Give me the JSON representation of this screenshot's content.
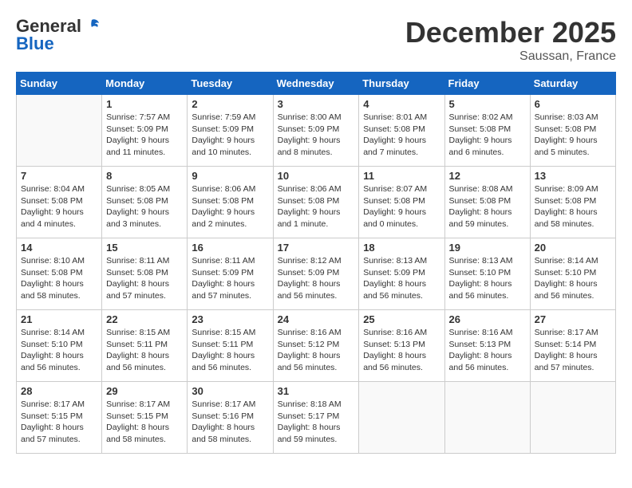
{
  "header": {
    "logo_general": "General",
    "logo_blue": "Blue",
    "month_year": "December 2025",
    "location": "Saussan, France"
  },
  "weekdays": [
    "Sunday",
    "Monday",
    "Tuesday",
    "Wednesday",
    "Thursday",
    "Friday",
    "Saturday"
  ],
  "weeks": [
    [
      {
        "day": "",
        "info": ""
      },
      {
        "day": "1",
        "info": "Sunrise: 7:57 AM\nSunset: 5:09 PM\nDaylight: 9 hours\nand 11 minutes."
      },
      {
        "day": "2",
        "info": "Sunrise: 7:59 AM\nSunset: 5:09 PM\nDaylight: 9 hours\nand 10 minutes."
      },
      {
        "day": "3",
        "info": "Sunrise: 8:00 AM\nSunset: 5:09 PM\nDaylight: 9 hours\nand 8 minutes."
      },
      {
        "day": "4",
        "info": "Sunrise: 8:01 AM\nSunset: 5:08 PM\nDaylight: 9 hours\nand 7 minutes."
      },
      {
        "day": "5",
        "info": "Sunrise: 8:02 AM\nSunset: 5:08 PM\nDaylight: 9 hours\nand 6 minutes."
      },
      {
        "day": "6",
        "info": "Sunrise: 8:03 AM\nSunset: 5:08 PM\nDaylight: 9 hours\nand 5 minutes."
      }
    ],
    [
      {
        "day": "7",
        "info": "Sunrise: 8:04 AM\nSunset: 5:08 PM\nDaylight: 9 hours\nand 4 minutes."
      },
      {
        "day": "8",
        "info": "Sunrise: 8:05 AM\nSunset: 5:08 PM\nDaylight: 9 hours\nand 3 minutes."
      },
      {
        "day": "9",
        "info": "Sunrise: 8:06 AM\nSunset: 5:08 PM\nDaylight: 9 hours\nand 2 minutes."
      },
      {
        "day": "10",
        "info": "Sunrise: 8:06 AM\nSunset: 5:08 PM\nDaylight: 9 hours\nand 1 minute."
      },
      {
        "day": "11",
        "info": "Sunrise: 8:07 AM\nSunset: 5:08 PM\nDaylight: 9 hours\nand 0 minutes."
      },
      {
        "day": "12",
        "info": "Sunrise: 8:08 AM\nSunset: 5:08 PM\nDaylight: 8 hours\nand 59 minutes."
      },
      {
        "day": "13",
        "info": "Sunrise: 8:09 AM\nSunset: 5:08 PM\nDaylight: 8 hours\nand 58 minutes."
      }
    ],
    [
      {
        "day": "14",
        "info": "Sunrise: 8:10 AM\nSunset: 5:08 PM\nDaylight: 8 hours\nand 58 minutes."
      },
      {
        "day": "15",
        "info": "Sunrise: 8:11 AM\nSunset: 5:08 PM\nDaylight: 8 hours\nand 57 minutes."
      },
      {
        "day": "16",
        "info": "Sunrise: 8:11 AM\nSunset: 5:09 PM\nDaylight: 8 hours\nand 57 minutes."
      },
      {
        "day": "17",
        "info": "Sunrise: 8:12 AM\nSunset: 5:09 PM\nDaylight: 8 hours\nand 56 minutes."
      },
      {
        "day": "18",
        "info": "Sunrise: 8:13 AM\nSunset: 5:09 PM\nDaylight: 8 hours\nand 56 minutes."
      },
      {
        "day": "19",
        "info": "Sunrise: 8:13 AM\nSunset: 5:10 PM\nDaylight: 8 hours\nand 56 minutes."
      },
      {
        "day": "20",
        "info": "Sunrise: 8:14 AM\nSunset: 5:10 PM\nDaylight: 8 hours\nand 56 minutes."
      }
    ],
    [
      {
        "day": "21",
        "info": "Sunrise: 8:14 AM\nSunset: 5:10 PM\nDaylight: 8 hours\nand 56 minutes."
      },
      {
        "day": "22",
        "info": "Sunrise: 8:15 AM\nSunset: 5:11 PM\nDaylight: 8 hours\nand 56 minutes."
      },
      {
        "day": "23",
        "info": "Sunrise: 8:15 AM\nSunset: 5:11 PM\nDaylight: 8 hours\nand 56 minutes."
      },
      {
        "day": "24",
        "info": "Sunrise: 8:16 AM\nSunset: 5:12 PM\nDaylight: 8 hours\nand 56 minutes."
      },
      {
        "day": "25",
        "info": "Sunrise: 8:16 AM\nSunset: 5:13 PM\nDaylight: 8 hours\nand 56 minutes."
      },
      {
        "day": "26",
        "info": "Sunrise: 8:16 AM\nSunset: 5:13 PM\nDaylight: 8 hours\nand 56 minutes."
      },
      {
        "day": "27",
        "info": "Sunrise: 8:17 AM\nSunset: 5:14 PM\nDaylight: 8 hours\nand 57 minutes."
      }
    ],
    [
      {
        "day": "28",
        "info": "Sunrise: 8:17 AM\nSunset: 5:15 PM\nDaylight: 8 hours\nand 57 minutes."
      },
      {
        "day": "29",
        "info": "Sunrise: 8:17 AM\nSunset: 5:15 PM\nDaylight: 8 hours\nand 58 minutes."
      },
      {
        "day": "30",
        "info": "Sunrise: 8:17 AM\nSunset: 5:16 PM\nDaylight: 8 hours\nand 58 minutes."
      },
      {
        "day": "31",
        "info": "Sunrise: 8:18 AM\nSunset: 5:17 PM\nDaylight: 8 hours\nand 59 minutes."
      },
      {
        "day": "",
        "info": ""
      },
      {
        "day": "",
        "info": ""
      },
      {
        "day": "",
        "info": ""
      }
    ]
  ]
}
